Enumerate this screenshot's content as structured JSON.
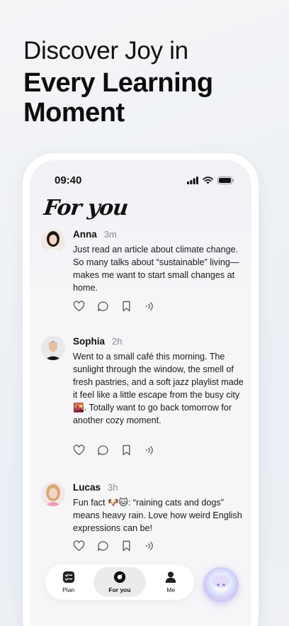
{
  "headline": {
    "line1": "Discover Joy in",
    "line2": "Every Learning",
    "line3": "Moment"
  },
  "status_bar": {
    "time": "09:40"
  },
  "feed": {
    "title": "For you",
    "posts": [
      {
        "author": "Anna",
        "time": "3m",
        "text": "Just read an article about climate change. So many talks about “sustainable” living—makes me want to start small changes at home."
      },
      {
        "author": "Sophia",
        "time": "2h",
        "text": "Went to a small café this morning. The sunlight through the window, the smell of fresh pastries, and a soft jazz playlist made it feel like a little escape from the busy city 🌇. Totally want to go back tomorrow for another cozy moment."
      },
      {
        "author": "Lucas",
        "time": "3h",
        "text": "Fun fact 🐶🐱: “raining cats and dogs” means heavy rain. Love how weird English expressions can be!"
      }
    ]
  },
  "tabbar": {
    "tabs": [
      {
        "label": "Plan",
        "icon": "plan-icon"
      },
      {
        "label": "For you",
        "icon": "for-you-icon",
        "active": true
      },
      {
        "label": "Me",
        "icon": "person-icon"
      }
    ]
  },
  "icons": [
    "heart-icon",
    "comment-icon",
    "bookmark-icon",
    "audio-icon",
    "signal-icon",
    "wifi-icon",
    "battery-icon"
  ]
}
